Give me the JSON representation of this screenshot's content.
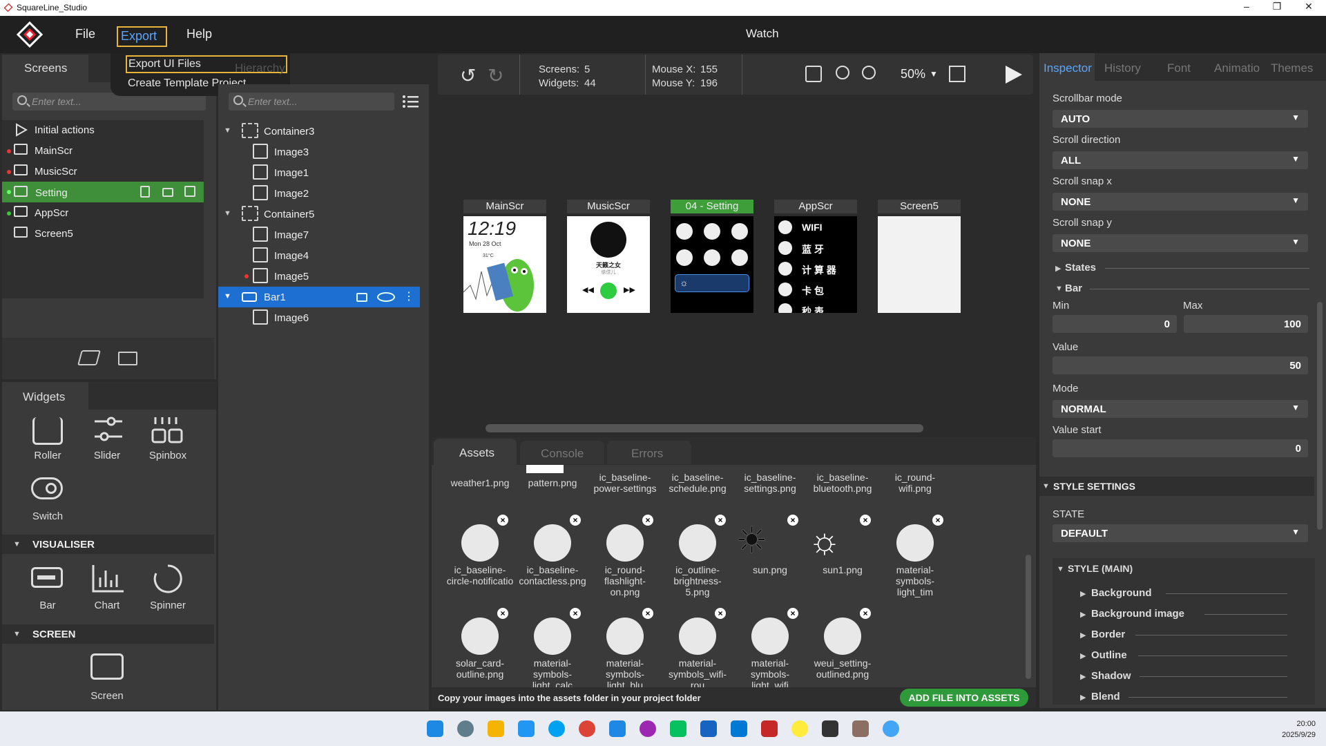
{
  "window": {
    "title": "SquareLine_Studio",
    "doc_title": "Watch"
  },
  "menu": {
    "file": "File",
    "export": "Export",
    "help": "Help"
  },
  "export_menu": {
    "item1": "Export UI Files",
    "item2": "Create Template Project"
  },
  "screens_panel": {
    "tab": "Screens",
    "tab2": "Hierarchy",
    "search_placeholder": "Enter text...",
    "items": [
      {
        "label": "Initial actions"
      },
      {
        "label": "MainScr"
      },
      {
        "label": "MusicScr"
      },
      {
        "label": "Setting"
      },
      {
        "label": "AppScr"
      },
      {
        "label": "Screen5"
      }
    ]
  },
  "hierarchy_panel": {
    "search_placeholder": "Enter text...",
    "items": [
      {
        "label": "Container3"
      },
      {
        "label": "Image3"
      },
      {
        "label": "Image1"
      },
      {
        "label": "Image2"
      },
      {
        "label": "Container5"
      },
      {
        "label": "Image7"
      },
      {
        "label": "Image4"
      },
      {
        "label": "Image5"
      },
      {
        "label": "Bar1"
      },
      {
        "label": "Image6"
      }
    ]
  },
  "widgets_panel": {
    "tab": "Widgets",
    "top": [
      {
        "label": "Roller"
      },
      {
        "label": "Slider"
      },
      {
        "label": "Spinbox"
      }
    ],
    "switch": "Switch",
    "visualiser_header": "VISUALISER",
    "visualiser": [
      {
        "label": "Bar"
      },
      {
        "label": "Chart"
      },
      {
        "label": "Spinner"
      }
    ],
    "screen_header": "SCREEN",
    "screen": "Screen"
  },
  "toolbar": {
    "screens_label": "Screens:",
    "screens_value": "5",
    "widgets_label": "Widgets:",
    "widgets_value": "44",
    "mousex_label": "Mouse X:",
    "mousex_value": "155",
    "mousey_label": "Mouse Y:",
    "mousey_value": "196",
    "zoom": "50%"
  },
  "screens": [
    {
      "name": "MainScr"
    },
    {
      "name": "MusicScr"
    },
    {
      "name": "04 - Setting"
    },
    {
      "name": "AppScr"
    },
    {
      "name": "Screen5"
    }
  ],
  "thumb_text": {
    "time": "12:19",
    "date": "Mon 28 Oct",
    "temp": "31°C",
    "song": "天籁之女",
    "artist": "徐佳儿",
    "app1": "WIFI",
    "app2": "蓝 牙",
    "app3": "计 算 器",
    "app4": "卡 包",
    "app5": "秒 表"
  },
  "bottom_tabs": {
    "assets": "Assets",
    "console": "Console",
    "errors": "Errors"
  },
  "assets_top": [
    {
      "label": "weather1.png"
    },
    {
      "label": "pattern.png"
    },
    {
      "label": "ic_baseline-power-settings"
    },
    {
      "label": "ic_baseline-schedule.png"
    },
    {
      "label": "ic_baseline-settings.png"
    },
    {
      "label": "ic_baseline-bluetooth.png"
    },
    {
      "label": "ic_round-wifi.png"
    }
  ],
  "assets_row1": [
    {
      "label": "ic_baseline-circle-notificatio",
      "icon": "bell-icon"
    },
    {
      "label": "ic_baseline-contactless.png",
      "icon": "contactless-icon"
    },
    {
      "label": "ic_round-flashlight-on.png",
      "icon": "flashlight-icon"
    },
    {
      "label": "ic_outline-brightness-5.png",
      "icon": "brightness-icon"
    },
    {
      "label": "sun.png",
      "icon": "sun-icon"
    },
    {
      "label": "sun1.png",
      "icon": "sun-icon"
    },
    {
      "label": "material-symbols-light_tim",
      "icon": "timer-icon"
    }
  ],
  "assets_row2": [
    {
      "label": "solar_card-outline.png",
      "icon": "card-icon"
    },
    {
      "label": "material-symbols-light_calc",
      "icon": "calculator-icon"
    },
    {
      "label": "material-symbols-light_blu",
      "icon": "bluetooth-icon"
    },
    {
      "label": "material-symbols_wifi-rou",
      "icon": "wifi-icon"
    },
    {
      "label": "material-symbols-light_wifi",
      "icon": "wifi-icon"
    },
    {
      "label": "weui_setting-outlined.png",
      "icon": "gear-icon"
    }
  ],
  "assets_footer": {
    "hint": "Copy your images into the assets folder in your project folder",
    "add_button": "ADD FILE INTO ASSETS"
  },
  "inspector": {
    "tabs": [
      "Inspector",
      "History",
      "Font",
      "Animatio",
      "Themes"
    ],
    "scrollbar_mode_label": "Scrollbar mode",
    "scrollbar_mode": "AUTO",
    "scroll_dir_label": "Scroll direction",
    "scroll_dir": "ALL",
    "snap_x_label": "Scroll snap x",
    "snap_x": "NONE",
    "snap_y_label": "Scroll snap y",
    "snap_y": "NONE",
    "states": "States",
    "bar": "Bar",
    "min_label": "Min",
    "min": "0",
    "max_label": "Max",
    "max": "100",
    "value_label": "Value",
    "value": "50",
    "mode_label": "Mode",
    "mode": "NORMAL",
    "value_start_label": "Value start",
    "value_start": "0",
    "style_settings": "STYLE SETTINGS",
    "state_label": "STATE",
    "state": "DEFAULT",
    "style_main": "STYLE (MAIN)",
    "style_items": [
      "Background",
      "Background image",
      "Border",
      "Outline",
      "Shadow",
      "Blend"
    ]
  },
  "clock": {
    "time": "20:00",
    "date": "2025/9/29"
  }
}
